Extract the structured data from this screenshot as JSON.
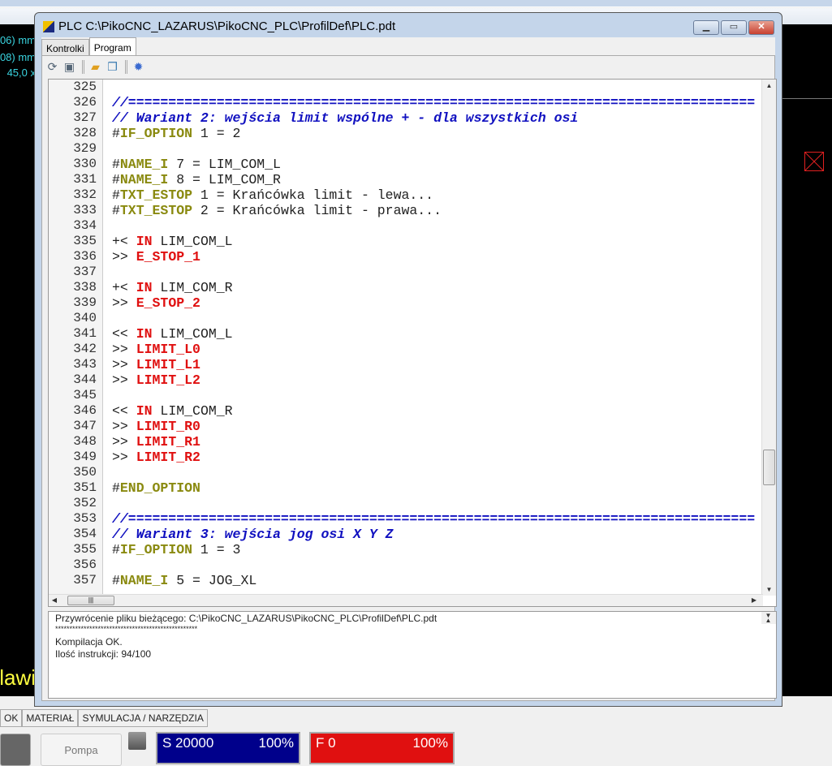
{
  "window": {
    "title": "PLC C:\\PikoCNC_LAZARUS\\PikoCNC_PLC\\ProfilDef\\PLC.pdt",
    "minimize": "▁",
    "maximize": "▭",
    "close": "✕"
  },
  "tabs": [
    {
      "label": "Kontrolki",
      "active": false
    },
    {
      "label": "Program",
      "active": true
    }
  ],
  "toolbar": {
    "icons": [
      "refresh-icon",
      "save-icon",
      "open-folder-icon",
      "copy-icon",
      "settings-gear-icon"
    ]
  },
  "background": {
    "left_lines": [
      "06) mm",
      "08) mm",
      "45,0 x"
    ],
    "left_yellow": "lawi",
    "bottom_tabs": [
      "OK",
      "MATERIAŁ",
      "SYMULACJA / NARZĘDZIA"
    ],
    "pompa": "Pompa",
    "spindle": {
      "label": "S 20000",
      "percent": "100%",
      "color": "#00008b"
    },
    "feed": {
      "label": "F 0",
      "percent": "100%",
      "color": "#e01010"
    }
  },
  "editor": {
    "lines": [
      {
        "n": "325",
        "t": []
      },
      {
        "n": "326",
        "t": [
          [
            "//==============================================================================",
            "cm"
          ]
        ]
      },
      {
        "n": "327",
        "t": [
          [
            "// Wariant 2: wejścia limit wspólne + - dla wszystkich osi",
            "cm"
          ]
        ]
      },
      {
        "n": "328",
        "t": [
          [
            "#",
            ""
          ],
          [
            "IF_OPTION",
            "kw"
          ],
          [
            " 1 = 2",
            ""
          ]
        ]
      },
      {
        "n": "329",
        "t": []
      },
      {
        "n": "330",
        "t": [
          [
            "#",
            ""
          ],
          [
            "NAME_I",
            "kw"
          ],
          [
            " 7 = LIM_COM_L",
            ""
          ]
        ]
      },
      {
        "n": "331",
        "t": [
          [
            "#",
            ""
          ],
          [
            "NAME_I",
            "kw"
          ],
          [
            " 8 = LIM_COM_R",
            ""
          ]
        ]
      },
      {
        "n": "332",
        "t": [
          [
            "#",
            ""
          ],
          [
            "TXT_ESTOP",
            "kw"
          ],
          [
            " 1 = Krańcówka limit - lewa...",
            ""
          ]
        ]
      },
      {
        "n": "333",
        "t": [
          [
            "#",
            ""
          ],
          [
            "TXT_ESTOP",
            "kw"
          ],
          [
            " 2 = Krańcówka limit - prawa...",
            ""
          ]
        ]
      },
      {
        "n": "334",
        "t": []
      },
      {
        "n": "335",
        "t": [
          [
            "+< ",
            ""
          ],
          [
            "IN",
            "rd"
          ],
          [
            " LIM_COM_L",
            ""
          ]
        ]
      },
      {
        "n": "336",
        "t": [
          [
            ">> ",
            ""
          ],
          [
            "E_STOP_1",
            "rd"
          ]
        ]
      },
      {
        "n": "337",
        "t": []
      },
      {
        "n": "338",
        "t": [
          [
            "+< ",
            ""
          ],
          [
            "IN",
            "rd"
          ],
          [
            " LIM_COM_R",
            ""
          ]
        ]
      },
      {
        "n": "339",
        "t": [
          [
            ">> ",
            ""
          ],
          [
            "E_STOP_2",
            "rd"
          ]
        ]
      },
      {
        "n": "340",
        "t": []
      },
      {
        "n": "341",
        "t": [
          [
            "<< ",
            ""
          ],
          [
            "IN",
            "rd"
          ],
          [
            " LIM_COM_L",
            ""
          ]
        ]
      },
      {
        "n": "342",
        "t": [
          [
            ">> ",
            ""
          ],
          [
            "LIMIT_L0",
            "rd"
          ]
        ]
      },
      {
        "n": "343",
        "t": [
          [
            ">> ",
            ""
          ],
          [
            "LIMIT_L1",
            "rd"
          ]
        ]
      },
      {
        "n": "344",
        "t": [
          [
            ">> ",
            ""
          ],
          [
            "LIMIT_L2",
            "rd"
          ]
        ]
      },
      {
        "n": "345",
        "t": []
      },
      {
        "n": "346",
        "t": [
          [
            "<< ",
            ""
          ],
          [
            "IN",
            "rd"
          ],
          [
            " LIM_COM_R",
            ""
          ]
        ]
      },
      {
        "n": "347",
        "t": [
          [
            ">> ",
            ""
          ],
          [
            "LIMIT_R0",
            "rd"
          ]
        ]
      },
      {
        "n": "348",
        "t": [
          [
            ">> ",
            ""
          ],
          [
            "LIMIT_R1",
            "rd"
          ]
        ]
      },
      {
        "n": "349",
        "t": [
          [
            ">> ",
            ""
          ],
          [
            "LIMIT_R2",
            "rd"
          ]
        ]
      },
      {
        "n": "350",
        "t": []
      },
      {
        "n": "351",
        "t": [
          [
            "#",
            ""
          ],
          [
            "END_OPTION",
            "kw"
          ]
        ]
      },
      {
        "n": "352",
        "t": []
      },
      {
        "n": "353",
        "t": [
          [
            "//==============================================================================",
            "cm"
          ]
        ]
      },
      {
        "n": "354",
        "t": [
          [
            "// Wariant 3: wejścia jog osi X Y Z",
            "cm"
          ]
        ]
      },
      {
        "n": "355",
        "t": [
          [
            "#",
            ""
          ],
          [
            "IF_OPTION",
            "kw"
          ],
          [
            " 1 = 3",
            ""
          ]
        ]
      },
      {
        "n": "356",
        "t": []
      },
      {
        "n": "357",
        "t": [
          [
            "#",
            ""
          ],
          [
            "NAME_I",
            "kw"
          ],
          [
            " 5 = JOG_XL",
            ""
          ]
        ]
      }
    ]
  },
  "output": {
    "lines": [
      "Przywrócenie pliku bieżącego: C:\\PikoCNC_LAZARUS\\PikoCNC_PLC\\ProfilDef\\PLC.pdt",
      "**************************************************",
      "Kompilacja OK.",
      "Ilość instrukcji: 94/100"
    ]
  }
}
